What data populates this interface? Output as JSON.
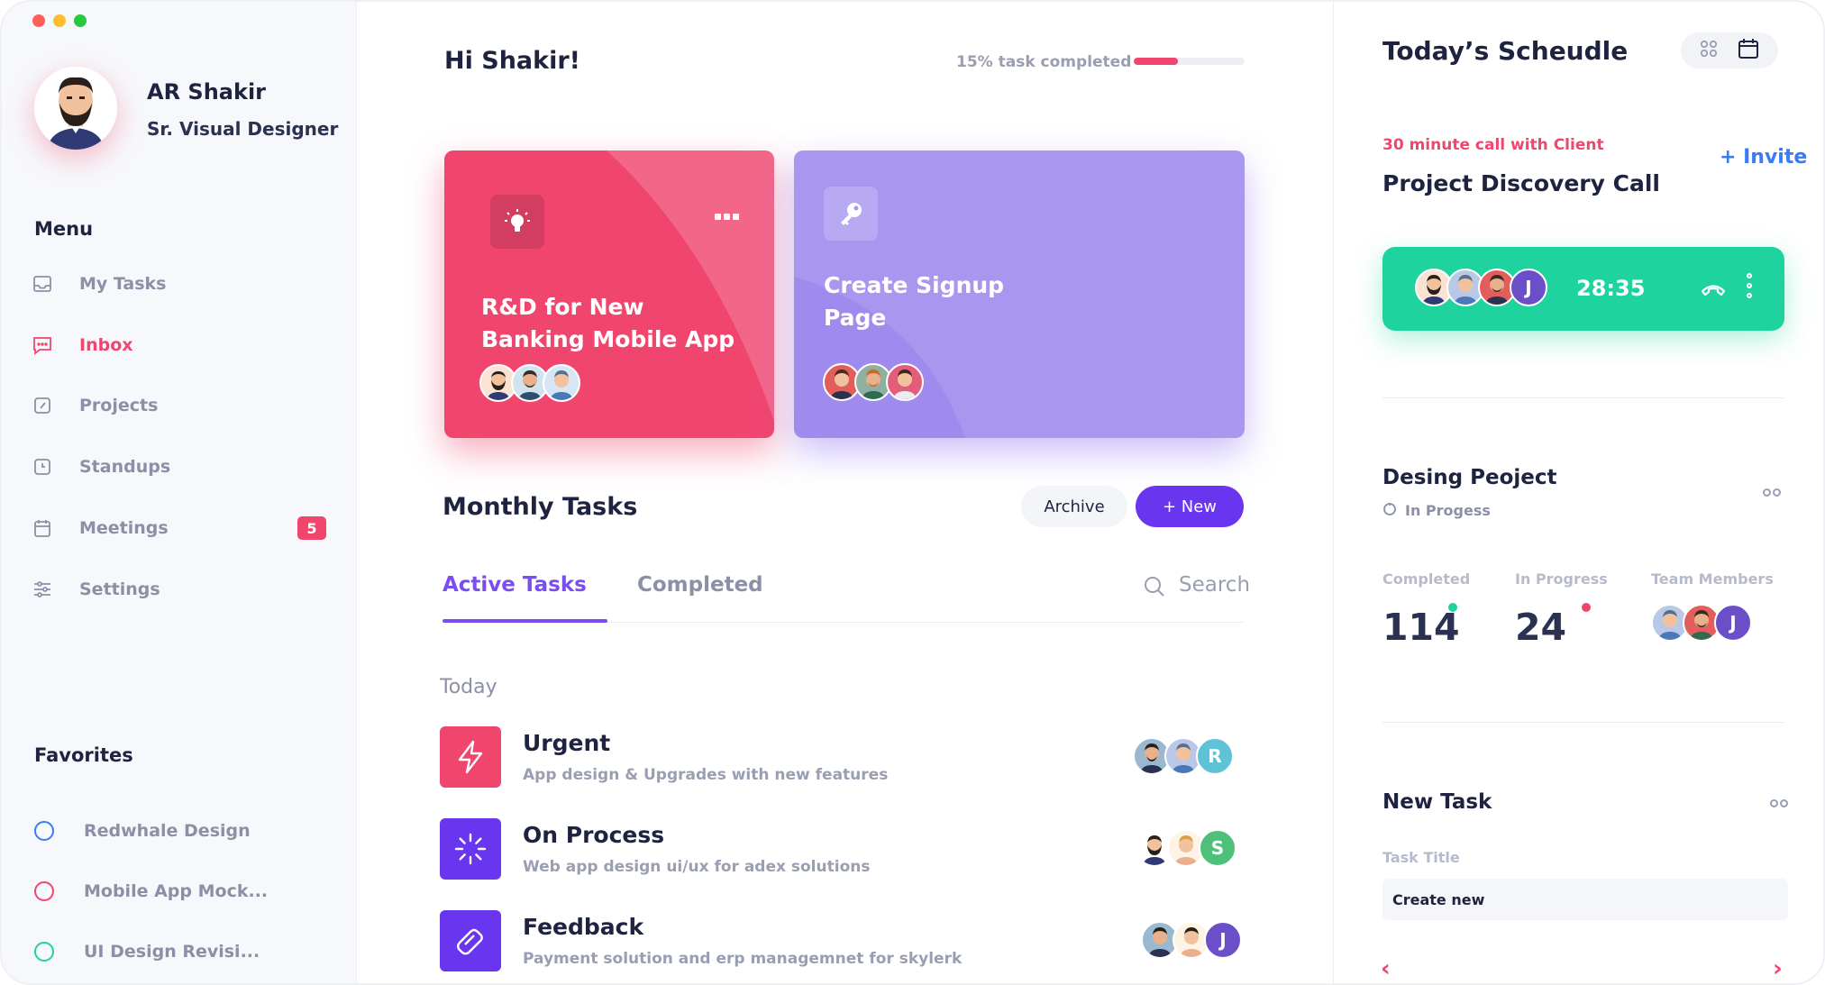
{
  "colors": {
    "accent_red": "#f0466e",
    "accent_purple": "#6a35ee",
    "card_purple": "#a896ef",
    "call_green": "#1ed39e",
    "invite_blue": "#3b7cf2"
  },
  "profile": {
    "name": "AR Shakir",
    "role": "Sr. Visual Designer"
  },
  "menu": {
    "title": "Menu",
    "items": [
      {
        "label": "My Tasks",
        "icon": "inbox-tray-icon"
      },
      {
        "label": "Inbox",
        "icon": "chat-icon",
        "active": true
      },
      {
        "label": "Projects",
        "icon": "projects-icon"
      },
      {
        "label": "Standups",
        "icon": "clock-icon"
      },
      {
        "label": "Meetings",
        "icon": "calendar-icon",
        "badge": "5"
      },
      {
        "label": "Settings",
        "icon": "sliders-icon"
      }
    ]
  },
  "favorites": {
    "title": "Favorites",
    "items": [
      {
        "label": "Redwhale Design",
        "color": "#3b7cf2"
      },
      {
        "label": "Mobile App Mock...",
        "color": "#f0466e"
      },
      {
        "label": "UI Design Revisi...",
        "color": "#1ed39e"
      }
    ]
  },
  "header": {
    "greeting": "Hi Shakir!",
    "progress_text": "15% task completed",
    "progress_fraction": 0.4
  },
  "cards": [
    {
      "title": "R&D for New Banking Mobile App",
      "icon": "lightbulb-icon"
    },
    {
      "title": "Create Signup Page",
      "icon": "key-icon"
    }
  ],
  "monthly": {
    "title": "Monthly Tasks",
    "archive_label": "Archive",
    "new_label": "+ New",
    "tab_active": "Active Tasks",
    "tab_completed": "Completed",
    "search_placeholder": "Search",
    "today_label": "Today",
    "tasks": [
      {
        "title": "Urgent",
        "subtitle": "App design & Upgrades with new features",
        "icon": "lightning-icon",
        "color": "#f0466e",
        "avatar_letter": "R"
      },
      {
        "title": "On Process",
        "subtitle": "Web app design ui/ux  for adex solutions",
        "icon": "loading-icon",
        "color": "#6a35ee",
        "avatar_letter": "S"
      },
      {
        "title": "Feedback",
        "subtitle": "Payment solution and erp managemnet for skylerk",
        "icon": "feedback-icon",
        "color": "#6a35ee",
        "avatar_letter": "J"
      }
    ]
  },
  "schedule": {
    "title": "Today’s Scheudle",
    "call_label": "30 minute call with Client",
    "invite_label": "+ Invite",
    "call_title": "Project Discovery Call",
    "call_time": "28:35",
    "call_avatar_letter": "J"
  },
  "project": {
    "title": "Desing Peoject",
    "status": "In Progess",
    "completed_label": "Completed",
    "completed_value": "114",
    "inprogress_label": "In Progress",
    "inprogress_value": "24",
    "team_label": "Team Members",
    "team_avatar_letter": "J"
  },
  "new_task": {
    "title": "New Task",
    "field_label": "Task Title",
    "field_placeholder": "Create new"
  }
}
